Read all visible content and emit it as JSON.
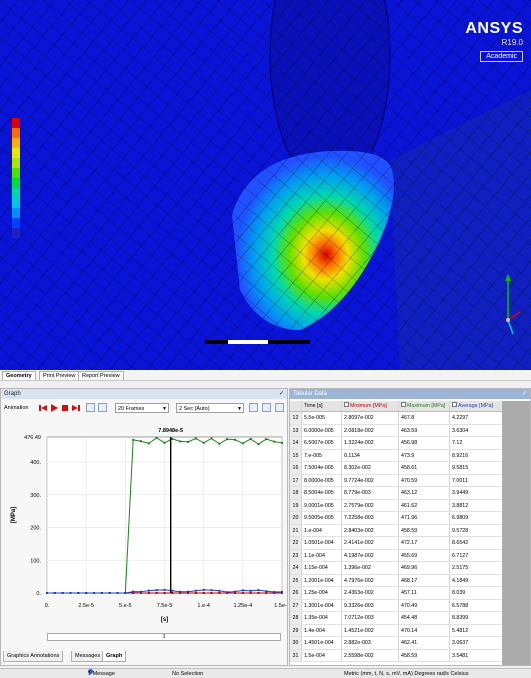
{
  "viewport": {
    "title_lines": [
      "",
      "",
      "",
      "",
      "",
      "",
      "",
      ""
    ],
    "legend": {
      "colors": [
        "#e00000",
        "#ff6a00",
        "#ffb000",
        "#e8e800",
        "#a8e800",
        "#50e000",
        "#00e030",
        "#00d8a0",
        "#00c8e0",
        "#0090f0",
        "#0040ff",
        "#2020c0"
      ],
      "values": [
        "",
        "",
        "",
        "",
        "",
        "",
        "",
        "",
        "",
        "",
        "",
        ""
      ]
    },
    "brand": {
      "name": "ANSYS",
      "version": "R19.0",
      "license": "Academic"
    }
  },
  "view_tabs": [
    "Geometry",
    "Print Preview",
    "Report Preview"
  ],
  "graph_panel": {
    "title": "Graph",
    "pin": "✓",
    "animation_label": "Animation",
    "frames": "20 Frames",
    "time_mode": "2 Sec (Auto)",
    "scroll_value": "1",
    "bottom_tabs": [
      "Graphics Annotations",
      "Messages",
      "Graph"
    ],
    "active_bottom_tab": "Graph"
  },
  "chart_data": {
    "type": "line",
    "ylabel": "[MPa]",
    "xlabel": "[s]",
    "top_y_label": "476.49",
    "y_ticks": [
      "400.",
      "300.",
      "200.",
      "100.",
      "0."
    ],
    "x_ticks": [
      "0.",
      "2.5e-5",
      "5.e-5",
      "7.5e-5",
      "1.e-4",
      "1.25e-4",
      "1.5e-4"
    ],
    "xlim": [
      0,
      0.00015
    ],
    "ylim": [
      0,
      476.49
    ],
    "cursor": {
      "label": "7.8948e-5",
      "x": 7.8948e-05
    },
    "x": [
      0,
      5e-06,
      1e-05,
      1.5e-05,
      2e-05,
      2.5e-05,
      3e-05,
      3.5e-05,
      4e-05,
      4.5e-05,
      5e-05,
      5.5e-05,
      6e-05,
      6.5e-05,
      7e-05,
      7.5e-05,
      8e-05,
      8.5e-05,
      9e-05,
      9.5e-05,
      0.0001,
      0.000105,
      0.00011,
      0.000115,
      0.00012,
      0.000125,
      0.00013,
      0.000135,
      0.00014,
      0.000145,
      0.00015
    ],
    "series": [
      {
        "name": "Minimum [MPa]",
        "color": "#c00000",
        "values": [
          0,
          0,
          0,
          0,
          0,
          0,
          0,
          0,
          0,
          0,
          0,
          0.028,
          0.021,
          0.013,
          0.011,
          0.0083,
          0.0097,
          0.0088,
          0.0028,
          0.0072,
          0.0029,
          0.0024,
          0.0042,
          0.0014,
          0.0047,
          0.0024,
          0.0093,
          0.0071,
          0.0145,
          0.0028,
          0.0026
        ]
      },
      {
        "name": "Maximum [MPa]",
        "color": "#208020",
        "values": [
          0,
          0,
          0,
          0,
          0,
          0,
          0,
          0,
          0,
          0,
          0,
          467.8,
          463.59,
          456.98,
          473.9,
          458.61,
          470.59,
          463.12,
          461.62,
          471.96,
          458.59,
          472.17,
          455.69,
          469.96,
          468.17,
          457.11,
          470.49,
          454.48,
          470.14,
          462.41,
          458.59
        ]
      },
      {
        "name": "Average [MPa]",
        "color": "#2040c0",
        "values": [
          0,
          0,
          0,
          0,
          0,
          0,
          0,
          0,
          0,
          0,
          0,
          4.2297,
          3.6304,
          7.12,
          8.9216,
          9.5815,
          7.0011,
          3.9449,
          3.8812,
          6.9809,
          9.5728,
          8.6542,
          6.7127,
          2.5175,
          4.1849,
          8.039,
          6.5788,
          8.8399,
          5.4812,
          3.0637,
          3.5481
        ]
      }
    ]
  },
  "tabular": {
    "title": "Tabular Data",
    "pin": "✓",
    "headers": [
      "",
      "Time [s]",
      "Minimum [MPa]",
      "Maximum [MPa]",
      "Average [MPa]"
    ],
    "rows": [
      [
        "12",
        "5.5e-005",
        "2.8097e-002",
        "467.8",
        "4.2297"
      ],
      [
        "13",
        "6.0000e-005",
        "2.0818e-002",
        "463.59",
        "3.6304"
      ],
      [
        "14",
        "6.5007e-005",
        "1.3224e-002",
        "456.98",
        "7.12"
      ],
      [
        "15",
        "7.e-005",
        "0.1134",
        "473.9",
        "8.9216"
      ],
      [
        "16",
        "7.5004e-005",
        "8.302e-002",
        "458.61",
        "9.5815"
      ],
      [
        "17",
        "8.0000e-005",
        "9.7724e-002",
        "470.59",
        "7.0011"
      ],
      [
        "18",
        "8.5004e-005",
        "8.779e-003",
        "463.12",
        "3.9449"
      ],
      [
        "19",
        "9.0001e-005",
        "2.7579e-002",
        "461.62",
        "3.8812"
      ],
      [
        "20",
        "9.5005e-005",
        "7.2258e-003",
        "471.96",
        "6.9809"
      ],
      [
        "21",
        "1.e-004",
        "2.8403e-002",
        "458.59",
        "9.5728"
      ],
      [
        "22",
        "1.0501e-004",
        "2.4141e-002",
        "472.17",
        "8.6542"
      ],
      [
        "23",
        "1.1e-004",
        "4.1987e-002",
        "455.69",
        "6.7127"
      ],
      [
        "24",
        "1.15e-004",
        "1.396e-002",
        "469.96",
        "2.5175"
      ],
      [
        "25",
        "1.2001e-004",
        "4.7976e-002",
        "468.17",
        "4.1849"
      ],
      [
        "26",
        "1.25e-004",
        "2.4363e-002",
        "457.11",
        "8.039"
      ],
      [
        "27",
        "1.3001e-004",
        "9.3326e-003",
        "470.49",
        "6.5788"
      ],
      [
        "28",
        "1.35e-004",
        "7.0712e-003",
        "454.48",
        "8.8399"
      ],
      [
        "29",
        "1.4e-004",
        "1.4521e-002",
        "470.14",
        "5.4812"
      ],
      [
        "30",
        "1.4501e-004",
        "2.882e-003",
        "462.41",
        "3.0637"
      ],
      [
        "31",
        "1.5e-004",
        "2.5598e-002",
        "458.59",
        "3.5481"
      ]
    ]
  },
  "status_bar": {
    "messages": "1 Message",
    "selection": "No Selection",
    "units": "Metric (mm, t, N, s, mV, mA)  Degrees  rad/s  Celsius"
  }
}
